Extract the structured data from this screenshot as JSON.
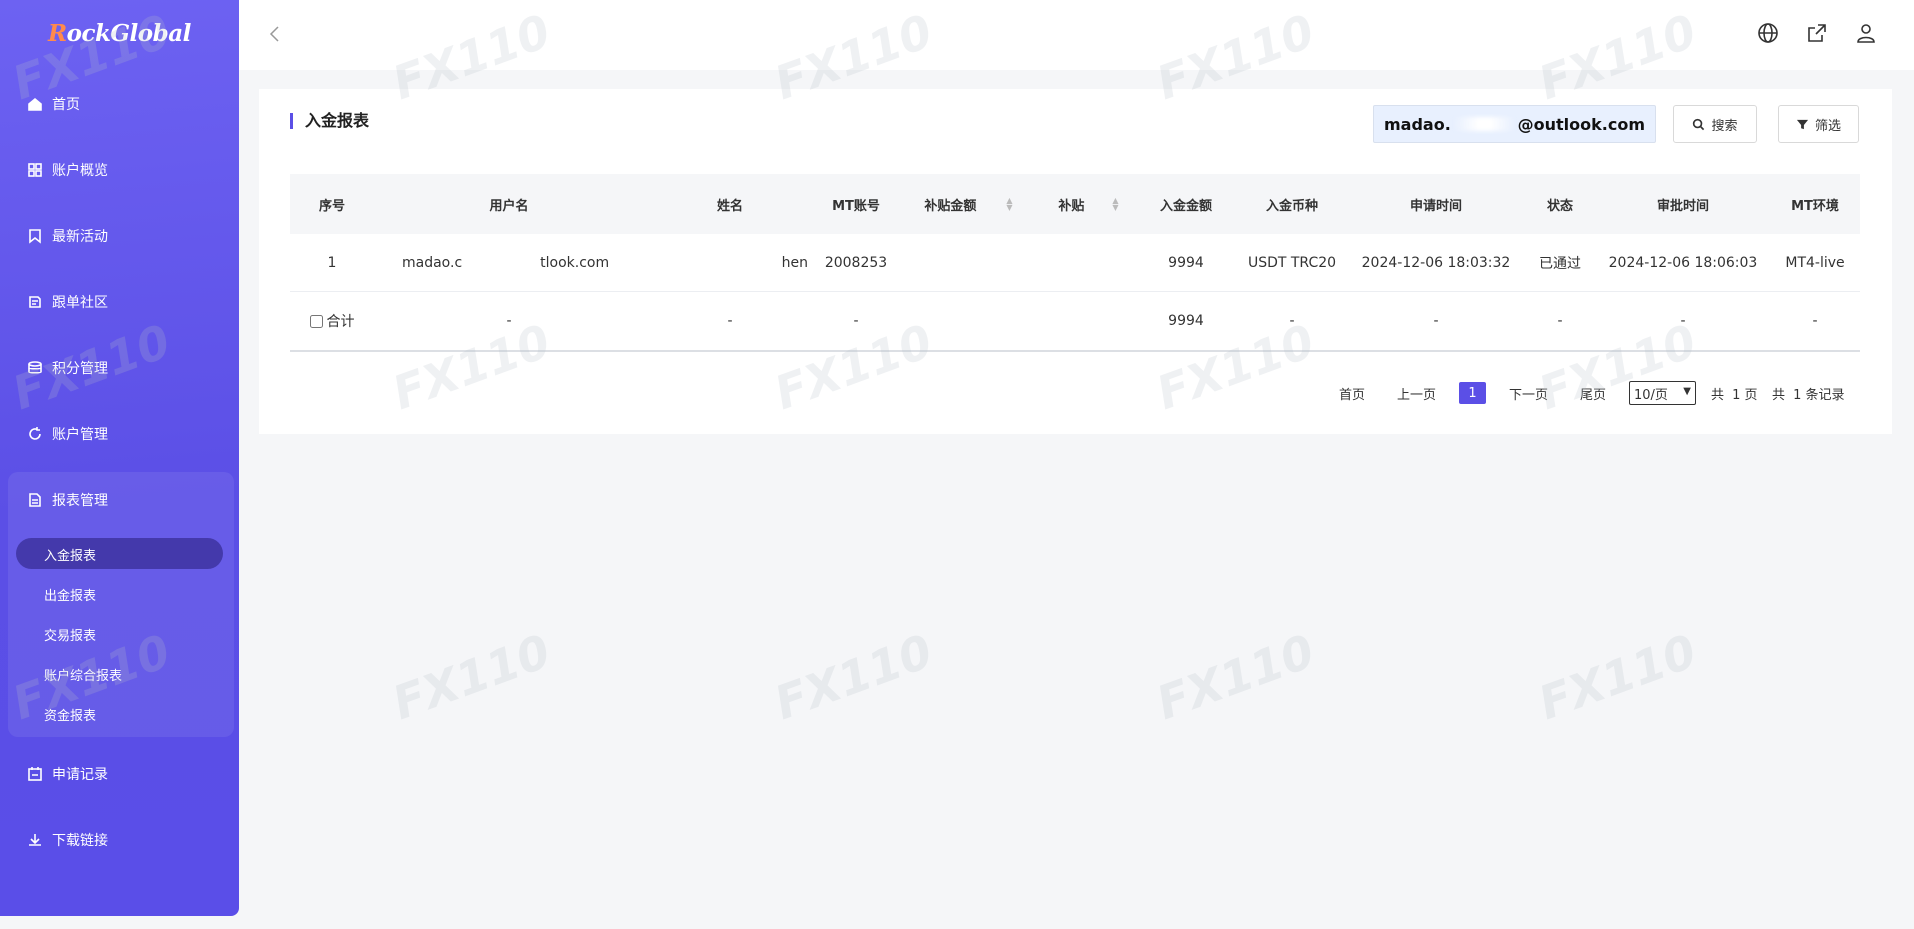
{
  "app": {
    "logo_prefix": "R",
    "logo_rest": "ockGlobal"
  },
  "sidebar": {
    "items": [
      {
        "label": "首页",
        "icon": "home-icon"
      },
      {
        "label": "账户概览",
        "icon": "grid-icon"
      },
      {
        "label": "最新活动",
        "icon": "bookmark-icon"
      },
      {
        "label": "跟单社区",
        "icon": "community-icon"
      },
      {
        "label": "积分管理",
        "icon": "database-icon"
      },
      {
        "label": "账户管理",
        "icon": "refresh-icon"
      },
      {
        "label": "报表管理",
        "icon": "report-icon"
      },
      {
        "label": "申请记录",
        "icon": "calendar-icon"
      },
      {
        "label": "下载链接",
        "icon": "download-icon"
      }
    ],
    "sub_items": [
      "入金报表",
      "出金报表",
      "交易报表",
      "账户综合报表",
      "资金报表"
    ]
  },
  "topbar": {
    "icons": [
      "globe-icon",
      "share-icon",
      "user-icon"
    ]
  },
  "page": {
    "title": "入金报表"
  },
  "search": {
    "prefix": "madao.",
    "suffix": "@outlook.com",
    "search_label": "搜索",
    "filter_label": "筛选"
  },
  "table": {
    "headers": [
      "序号",
      "用户名",
      "姓名",
      "MT账号",
      "补贴金额",
      "补贴",
      "入金金额",
      "入金币种",
      "申请时间",
      "状态",
      "审批时间",
      "MT环境"
    ],
    "rows": [
      [
        "1",
        "madao.c",
        "tlook.com",
        "hen",
        "2008253",
        "",
        "",
        "9994",
        "USDT TRC20",
        "2024-12-06 18:03:32",
        "已通过",
        "2024-12-06 18:06:03",
        "MT4-live"
      ]
    ],
    "total": [
      "合计",
      "-",
      "-",
      "-",
      "",
      "",
      "9994",
      "-",
      "-",
      "-",
      "-",
      "-"
    ]
  },
  "pager": {
    "first": "首页",
    "prev": "上一页",
    "current": "1",
    "next": "下一页",
    "last": "尾页",
    "page_size": "10/页",
    "total_pages_prefix": "共",
    "total_pages": "1",
    "total_pages_suffix": "页",
    "total_records_prefix": "共",
    "total_records": "1",
    "total_records_suffix": "条记录"
  },
  "colors": {
    "accent": "#5b4fe6",
    "sidebar": "#6258ec",
    "logo_r": "#ff8a4c"
  }
}
